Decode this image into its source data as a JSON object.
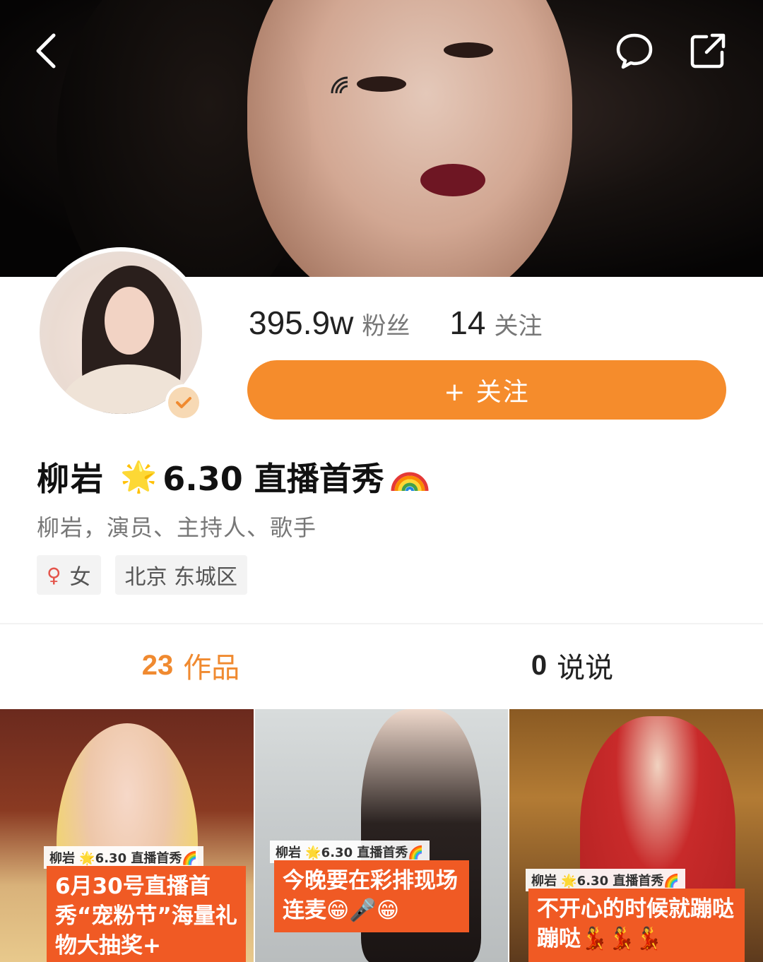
{
  "header": {
    "back_icon": "chevron-left-icon",
    "comment_icon": "comment-bubble-icon",
    "share_icon": "share-icon"
  },
  "profile": {
    "followers_count": "395.9w",
    "followers_label": "粉丝",
    "following_count": "14",
    "following_label": "关注",
    "follow_button_label": "+ 关注",
    "name": "柳岩",
    "star_emoji": "🌟",
    "tagline": "6.30 直播首秀",
    "bio": "柳岩，演员、主持人、歌手",
    "gender_icon": "female-icon",
    "gender": "女",
    "location": "北京 东城区",
    "verified_badge_icon": "verified-check-icon"
  },
  "tabs": [
    {
      "count": "23",
      "label": "作品",
      "active": true
    },
    {
      "count": "0",
      "label": "说说",
      "active": false
    }
  ],
  "posts": [
    {
      "chip": "柳岩 🌟6.30 直播首秀🌈",
      "caption": "6月30号直播首秀“宠粉节”海量礼物大抽奖+"
    },
    {
      "chip": "柳岩 🌟6.30 直播首秀🌈",
      "caption": "今晚要在彩排现场连麦😁🎤😁"
    },
    {
      "chip": "柳岩 🌟6.30 直播首秀🌈",
      "caption": "不开心的时候就蹦哒蹦哒💃💃💃"
    }
  ],
  "colors": {
    "accent": "#f58c2c",
    "tab_active": "#f08a30",
    "caption_bg": "#f05a24"
  }
}
